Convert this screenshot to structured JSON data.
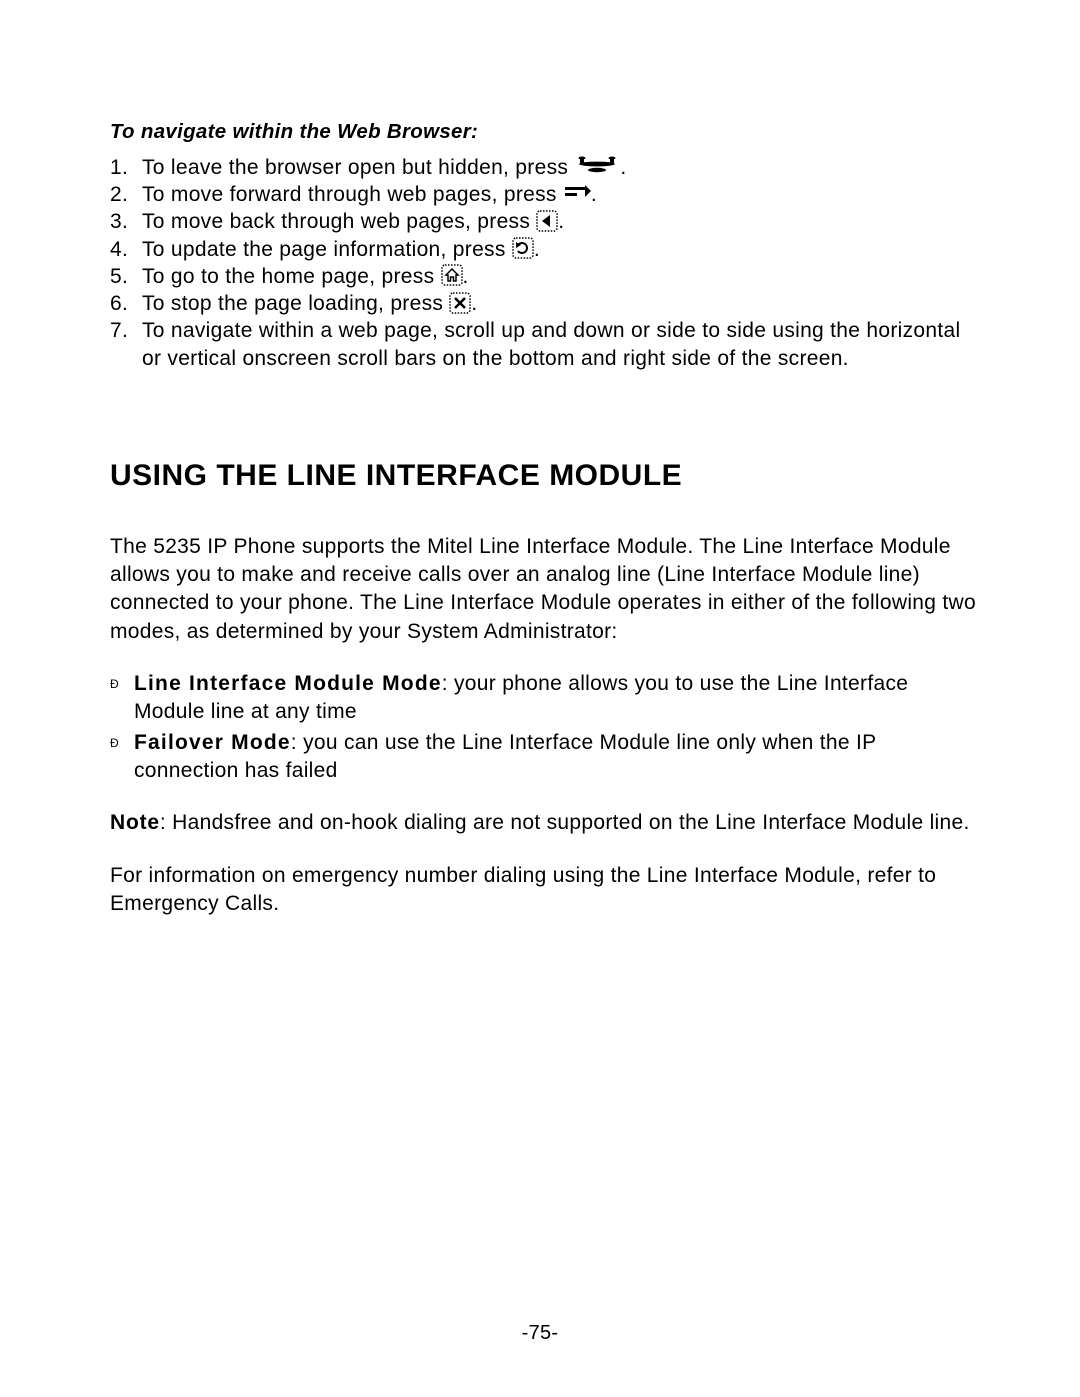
{
  "subheading": "To navigate within the Web Browser:",
  "steps": [
    {
      "num": "1.",
      "pre": "To leave the browser open but hidden, press",
      "post": "."
    },
    {
      "num": "2.",
      "pre": "To move forward through web pages, press",
      "post": "."
    },
    {
      "num": "3.",
      "pre": "To move back through web pages, press",
      "post": "."
    },
    {
      "num": "4.",
      "pre": "To update the page information, press",
      "post": "."
    },
    {
      "num": "5.",
      "pre": "To go to the home page, press",
      "post": "."
    },
    {
      "num": "6.",
      "pre": "To stop the page loading, press",
      "post": "."
    },
    {
      "num": "7.",
      "pre": "To navigate within a web page, scroll up and down or side to side using the horizontal or vertical onscreen scroll bars on the bottom and right side of the screen.",
      "post": ""
    }
  ],
  "section_title": "USING THE LINE INTERFACE MODULE",
  "para1": "The 5235 IP Phone supports the Mitel Line Interface Module. The Line Interface Module allows you to make and receive calls over an analog line (Line Interface Module line) connected to your phone. The Line Interface Module operates in either of the following two modes, as determined by your System Administrator:",
  "bullets": {
    "b1_label": "Line Interface Module Mode",
    "b1_rest": ": your phone allows you to use the Line Interface Module line at any time",
    "b2_label": "Failover Mode",
    "b2_rest": ": you can use the Line Interface Module line only when the IP connection has failed"
  },
  "para2_label": "Note",
  "para2_rest": ": Handsfree and on-hook dialing are not supported on the Line Interface Module line.",
  "para3": "For information on emergency number dialing using the Line Interface Module, refer to Emergency Calls.",
  "page_number": "-75-"
}
